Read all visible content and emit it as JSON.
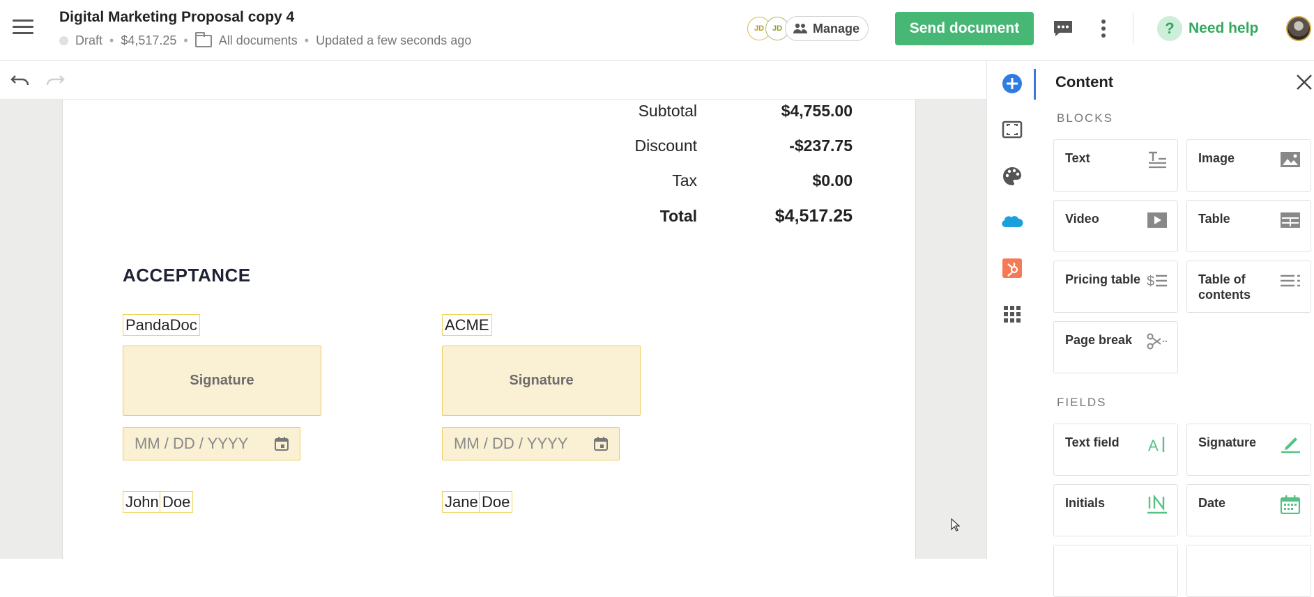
{
  "header": {
    "title": "Digital Marketing Proposal copy 4",
    "status": "Draft",
    "amount": "$4,517.25",
    "folder": "All documents",
    "updated": "Updated a few seconds ago",
    "avatars": [
      "JD",
      "JD"
    ],
    "manage_label": "Manage",
    "send_label": "Send document",
    "help_label": "Need help",
    "help_glyph": "?"
  },
  "summary": [
    {
      "label": "Subtotal",
      "value": "$4,755.00"
    },
    {
      "label": "Discount",
      "value": "-$237.75"
    },
    {
      "label": "Tax",
      "value": "$0.00"
    },
    {
      "label": "Total",
      "value": "$4,517.25"
    }
  ],
  "acceptance": {
    "title": "ACCEPTANCE",
    "left": {
      "company": "PandaDoc",
      "signature_label": "Signature",
      "date_placeholder": "MM / DD / YYYY",
      "first": "John",
      "last": "Doe"
    },
    "right": {
      "company": "ACME",
      "signature_label": "Signature",
      "date_placeholder": "MM / DD / YYYY",
      "first": "Jane",
      "last": "Doe"
    }
  },
  "panel": {
    "title": "Content",
    "blocks_heading": "BLOCKS",
    "fields_heading": "FIELDS",
    "blocks": [
      {
        "label": "Text",
        "icon": "text-block-icon"
      },
      {
        "label": "Image",
        "icon": "image-block-icon"
      },
      {
        "label": "Video",
        "icon": "video-block-icon"
      },
      {
        "label": "Table",
        "icon": "table-block-icon"
      },
      {
        "label": "Pricing table",
        "icon": "pricing-table-icon"
      },
      {
        "label": "Table of contents",
        "icon": "toc-icon"
      },
      {
        "label": "Page break",
        "icon": "scissors-icon"
      }
    ],
    "fields": [
      {
        "label": "Text field",
        "icon": "text-field-icon"
      },
      {
        "label": "Signature",
        "icon": "pen-icon"
      },
      {
        "label": "Initials",
        "icon": "initials-icon"
      },
      {
        "label": "Date",
        "icon": "calendar-icon"
      }
    ]
  },
  "colors": {
    "accent_green": "#47b775",
    "field_fill": "#faf0d3",
    "field_border": "#eecd63",
    "rail_blue": "#2f7de1"
  }
}
